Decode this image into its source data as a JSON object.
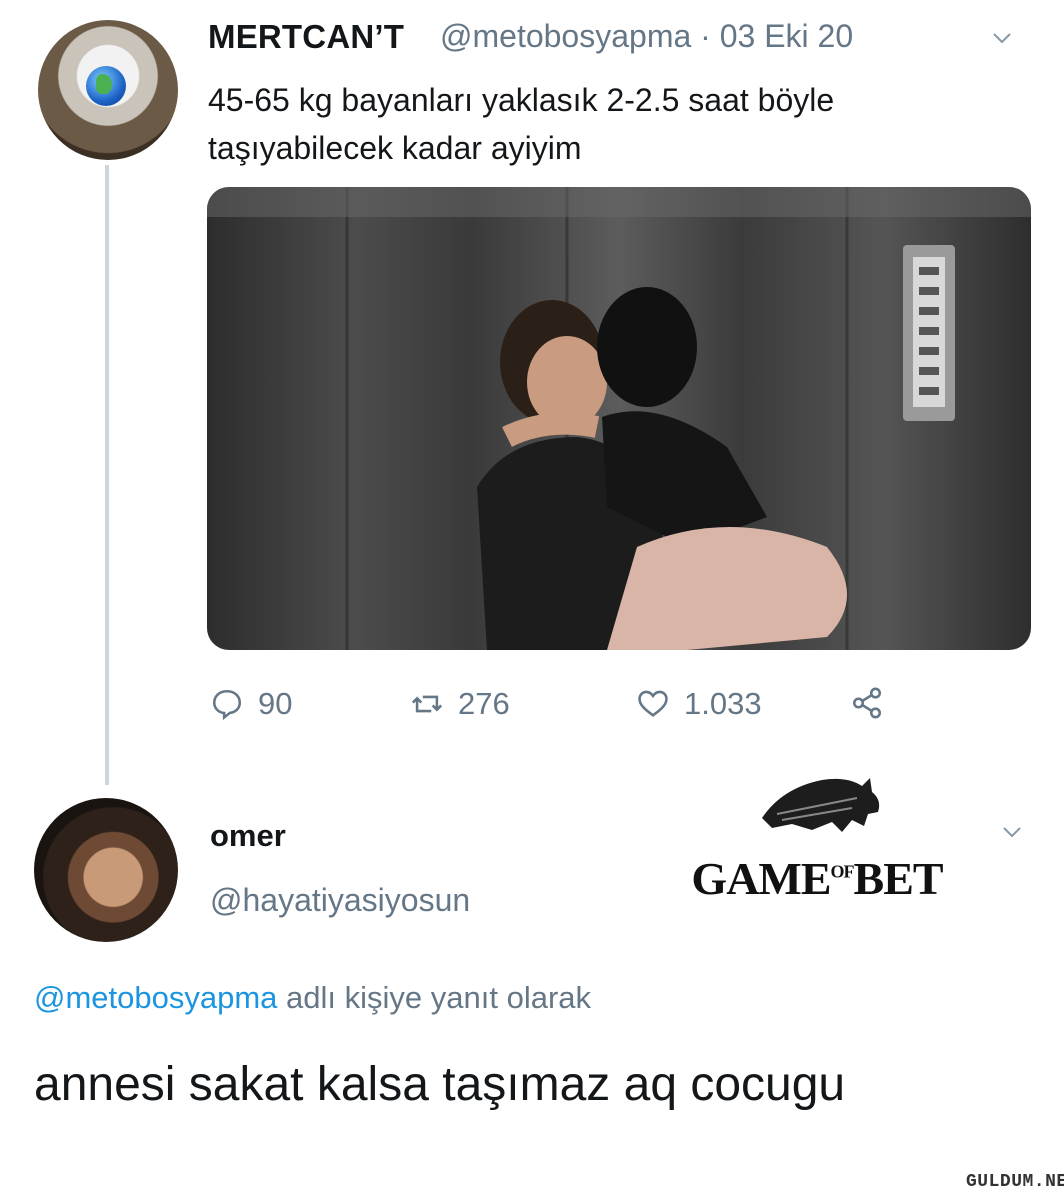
{
  "tweet": {
    "author_name": "MERTCAN’T",
    "author_handle": "@metobosyapma",
    "date": "· 03 Eki 20",
    "text": "45-65 kg bayanları yaklasık 2-2.5 saat böyle taşıyabilecek kadar ayiyim",
    "actions": {
      "replies": "90",
      "retweets": "276",
      "likes": "1.033"
    },
    "icons": {
      "reply": "comment-icon",
      "retweet": "retweet-icon",
      "like": "heart-icon",
      "share": "share-icon",
      "menu": "chevron-down-icon"
    }
  },
  "reply": {
    "author_name": "omer",
    "author_handle": "@hayatiyasiyosun",
    "replying_to_mention": "@metobosyapma",
    "replying_to_suffix": " adlı kişiye yanıt olarak",
    "text": "annesi sakat kalsa taşımaz aq cocugu"
  },
  "overlay_logo": {
    "text": "GAME",
    "of": "OF",
    "text2": "BET"
  },
  "watermark": "GULDUM.NET",
  "colors": {
    "secondary_text": "#657786",
    "link": "#1b95e0",
    "thread_line": "#ccd6dd"
  }
}
